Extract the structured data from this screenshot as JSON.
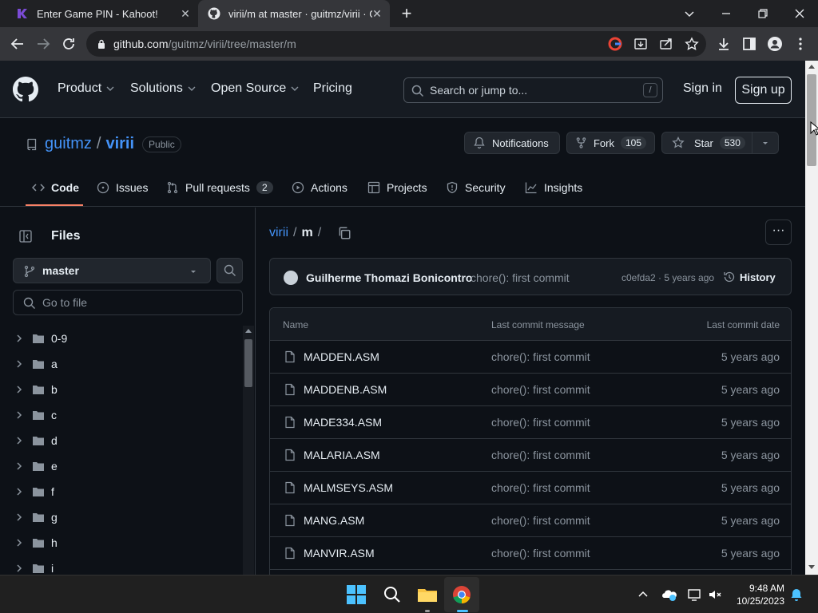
{
  "browser": {
    "tabs": [
      {
        "title": "Enter Game PIN - Kahoot!",
        "icon": "kahoot-icon"
      },
      {
        "title": "virii/m at master · guitmz/virii · G",
        "icon": "github-icon"
      }
    ],
    "url_host": "github.com",
    "url_path": "/guitmz/virii/tree/master/m"
  },
  "github_header": {
    "nav": [
      "Product",
      "Solutions",
      "Open Source",
      "Pricing"
    ],
    "search_placeholder": "Search or jump to...",
    "search_kbd": "/",
    "sign_in": "Sign in",
    "sign_up": "Sign up"
  },
  "repo": {
    "owner": "guitmz",
    "sep": "/",
    "name": "virii",
    "visibility": "Public",
    "notifications_label": "Notifications",
    "fork_label": "Fork",
    "fork_count": "105",
    "star_label": "Star",
    "star_count": "530",
    "tabs": [
      {
        "label": "Code",
        "icon": "code-icon"
      },
      {
        "label": "Issues",
        "icon": "issue-icon"
      },
      {
        "label": "Pull requests",
        "icon": "pull-request-icon",
        "count": "2"
      },
      {
        "label": "Actions",
        "icon": "play-icon"
      },
      {
        "label": "Projects",
        "icon": "table-icon"
      },
      {
        "label": "Security",
        "icon": "shield-icon"
      },
      {
        "label": "Insights",
        "icon": "graph-icon"
      }
    ]
  },
  "sidebar": {
    "title": "Files",
    "branch": "master",
    "goto_placeholder": "Go to file",
    "tree": [
      "0-9",
      "a",
      "b",
      "c",
      "d",
      "e",
      "f",
      "g",
      "h",
      "i"
    ]
  },
  "main": {
    "breadcrumb_repo": "virii",
    "breadcrumb_sep": "/",
    "breadcrumb_dir": "m",
    "breadcrumb_trail": "/",
    "more": "···",
    "commit": {
      "author": "Guilherme Thomazi Bonicontro",
      "message": "chore(): first commit",
      "meta": "c0efda2 · 5 years ago",
      "history": "History"
    },
    "table_headers": {
      "name": "Name",
      "message": "Last commit message",
      "date": "Last commit date"
    },
    "files": [
      {
        "name": "MADDEN.ASM",
        "message": "chore(): first commit",
        "date": "5 years ago"
      },
      {
        "name": "MADDENB.ASM",
        "message": "chore(): first commit",
        "date": "5 years ago"
      },
      {
        "name": "MADE334.ASM",
        "message": "chore(): first commit",
        "date": "5 years ago"
      },
      {
        "name": "MALARIA.ASM",
        "message": "chore(): first commit",
        "date": "5 years ago"
      },
      {
        "name": "MALMSEYS.ASM",
        "message": "chore(): first commit",
        "date": "5 years ago"
      },
      {
        "name": "MANG.ASM",
        "message": "chore(): first commit",
        "date": "5 years ago"
      },
      {
        "name": "MANVIR.ASM",
        "message": "chore(): first commit",
        "date": "5 years ago"
      }
    ]
  },
  "taskbar": {
    "time": "9:48 AM",
    "date": "10/25/2023"
  },
  "colors": {
    "link": "#4493f8",
    "tab_underline": "#f78166",
    "background": "#0d1117"
  }
}
